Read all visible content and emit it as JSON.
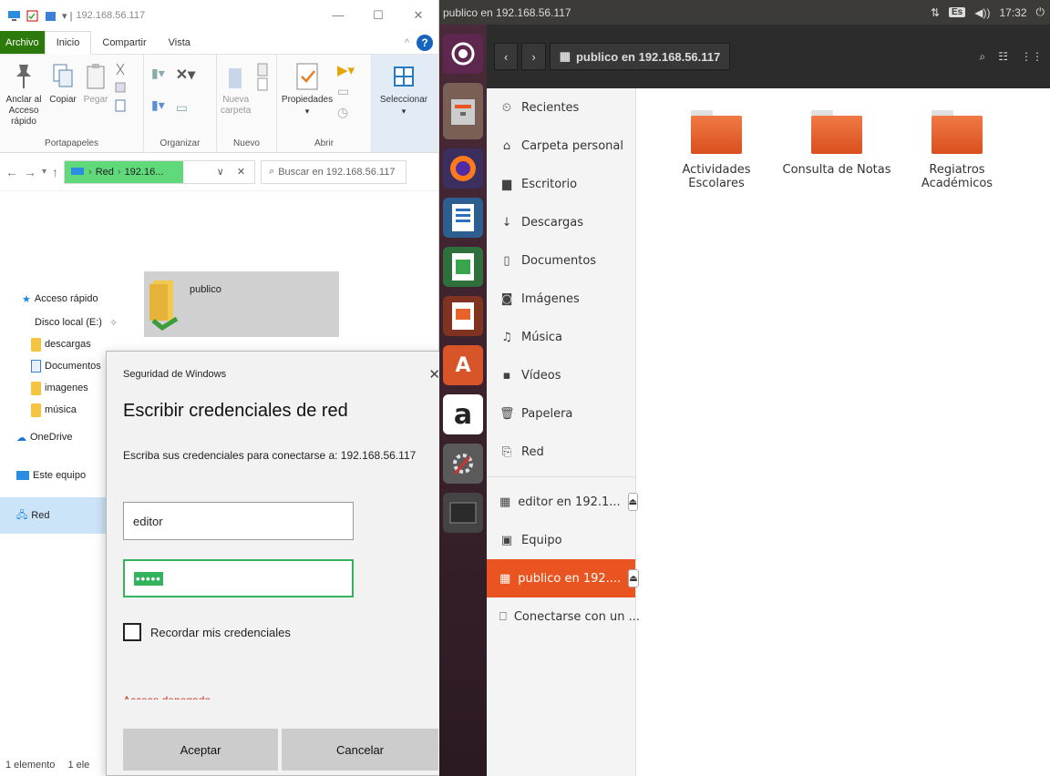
{
  "explorer": {
    "title": "192.168.56.117",
    "tabs": [
      "Archivo",
      "Inicio",
      "Compartir",
      "Vista"
    ],
    "ribbon": {
      "pin_label": "Anclar al\nAcceso rápido",
      "copy_label": "Copiar",
      "paste_label": "Pegar",
      "group_clipboard": "Portapapeles",
      "group_organize": "Organizar",
      "new_folder_label": "Nueva\ncarpeta",
      "group_new": "Nuevo",
      "properties_label": "Propiedades",
      "group_open": "Abrir",
      "select_label": "Seleccionar"
    },
    "address": {
      "crumb1": "Red",
      "crumb2": "192.16..."
    },
    "search_placeholder": "Buscar en 192.168.56.117",
    "nav": {
      "quick_access": "Acceso rápido",
      "local_disk": "Disco local (E:)",
      "descargas": "descargas",
      "documentos": "Documentos",
      "imagenes": "imagenes",
      "musica": "música",
      "onedrive": "OneDrive",
      "this_pc": "Este equipo",
      "network": "Red"
    },
    "item_name": "publico",
    "status_count": "1 elemento",
    "status_sel": "1 ele"
  },
  "dialog": {
    "window_title": "Seguridad de Windows",
    "heading": "Escribir credenciales de red",
    "message": "Escriba sus credenciales para conectarse a: 192.168.56.117",
    "username": "editor",
    "password_mask": "•••••",
    "remember": "Recordar mis credenciales",
    "error": "Acceso denegado",
    "ok": "Aceptar",
    "cancel": "Cancelar"
  },
  "ubuntu": {
    "window_title": "publico en 192.168.56.117",
    "lang": "Es",
    "time": "17:32",
    "location": "publico en 192.168.56.117",
    "places": [
      {
        "icon": "⏲",
        "label": "Recientes"
      },
      {
        "icon": "⌂",
        "label": "Carpeta personal"
      },
      {
        "icon": "▆",
        "label": "Escritorio"
      },
      {
        "icon": "↓",
        "label": "Descargas"
      },
      {
        "icon": "▯",
        "label": "Documentos"
      },
      {
        "icon": "◙",
        "label": "Imágenes"
      },
      {
        "icon": "♫",
        "label": "Música"
      },
      {
        "icon": "▪",
        "label": "Vídeos"
      },
      {
        "icon": "🗑",
        "label": "Papelera"
      },
      {
        "icon": "⎘",
        "label": "Red"
      }
    ],
    "mounts": [
      {
        "label": "editor en 192.1...",
        "selected": false
      },
      {
        "label": "Equipo",
        "selected": false
      },
      {
        "label": "publico en 192....",
        "selected": true
      },
      {
        "label": "Conectarse con un ...",
        "selected": false
      }
    ],
    "folders": [
      {
        "line1": "Actividades",
        "line2": "Escolares"
      },
      {
        "line1": "Consulta de Notas",
        "line2": ""
      },
      {
        "line1": "Regiatros",
        "line2": "Académicos"
      }
    ],
    "accent": "#e95420"
  }
}
